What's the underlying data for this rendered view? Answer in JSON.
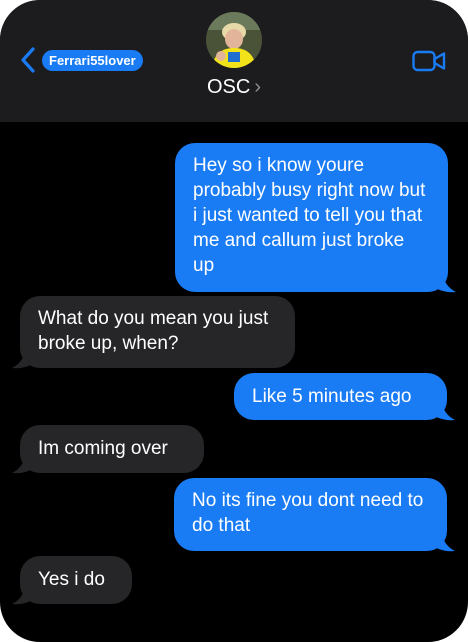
{
  "header": {
    "back_label": "Ferrari55lover",
    "contact_name": "OSC",
    "contact_chevron": "›",
    "icons": {
      "back": "chevron-left-icon",
      "video": "video-camera-icon",
      "avatar": "contact-avatar"
    }
  },
  "colors": {
    "sent": "#1a7cf5",
    "received": "#262628",
    "header": "#1c1c1e",
    "background": "#000000"
  },
  "messages": [
    {
      "from": "me",
      "text": "Hey so i know youre probably busy right now but i just wanted to tell you that me and callum just broke up"
    },
    {
      "from": "them",
      "text": "What do you mean you just broke up, when?"
    },
    {
      "from": "me",
      "text": "Like 5 minutes ago"
    },
    {
      "from": "them",
      "text": "Im coming over"
    },
    {
      "from": "me",
      "text": "No its fine you dont need to do that"
    },
    {
      "from": "them",
      "text": "Yes i do"
    }
  ]
}
